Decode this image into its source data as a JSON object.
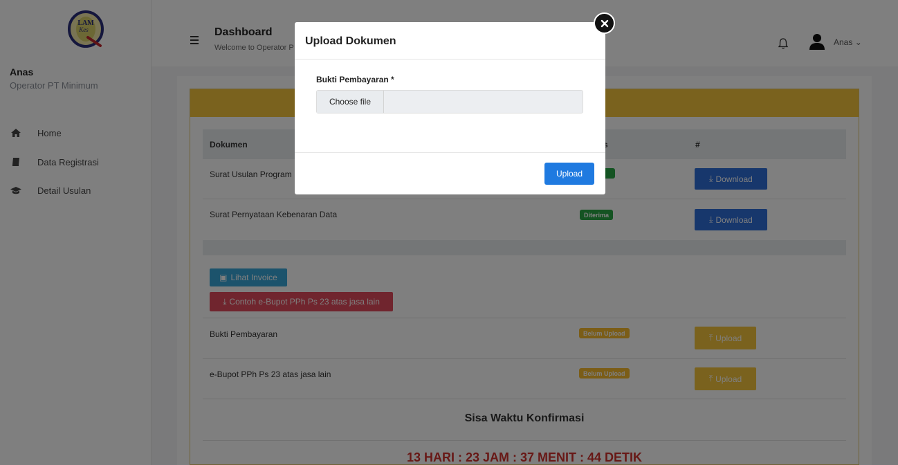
{
  "sidebar": {
    "user_name": "Anas",
    "user_role": "Operator PT Minimum",
    "logo_text": "LAM Kes",
    "items": [
      {
        "label": "Home",
        "icon": "home-icon"
      },
      {
        "label": "Data Registrasi",
        "icon": "book-icon"
      },
      {
        "label": "Detail Usulan",
        "icon": "graduation-cap-icon"
      }
    ]
  },
  "header": {
    "title": "Dashboard",
    "subtitle": "Welcome to Operator P",
    "user_label": "Anas",
    "user_chevron": "⌄"
  },
  "table": {
    "col_dokumen": "Dokumen",
    "col_status": "s",
    "col_action": "#",
    "rows": [
      {
        "name": "Surat Usulan Program",
        "status": "",
        "action": "Download"
      },
      {
        "name": "Surat Pernyataan Kebenaran Data",
        "status": "Diterima",
        "action": "Download"
      }
    ],
    "invoice_button": "Lihat Invoice",
    "sample_button": "Contoh e-Bupot PPh Ps 23 atas jasa lain",
    "upload_rows": [
      {
        "name": "Bukti Pembayaran",
        "status": "Belum Upload",
        "action": "Upload"
      },
      {
        "name": "e-Bupot PPh Ps 23 atas jasa lain",
        "status": "Belum Upload",
        "action": "Upload"
      }
    ],
    "countdown_title": "Sisa Waktu Konfirmasi",
    "countdown_value": "13 HARI : 23 JAM : 37 MENIT : 44 DETIK"
  },
  "modal": {
    "title": "Upload Dokumen",
    "field_label": "Bukti Pembayaran *",
    "file_button": "Choose file",
    "file_name": "",
    "submit_label": "Upload"
  },
  "colors": {
    "card_header": "#f4c43c",
    "primary": "#1f7ae0",
    "danger_text": "#d0312d"
  }
}
